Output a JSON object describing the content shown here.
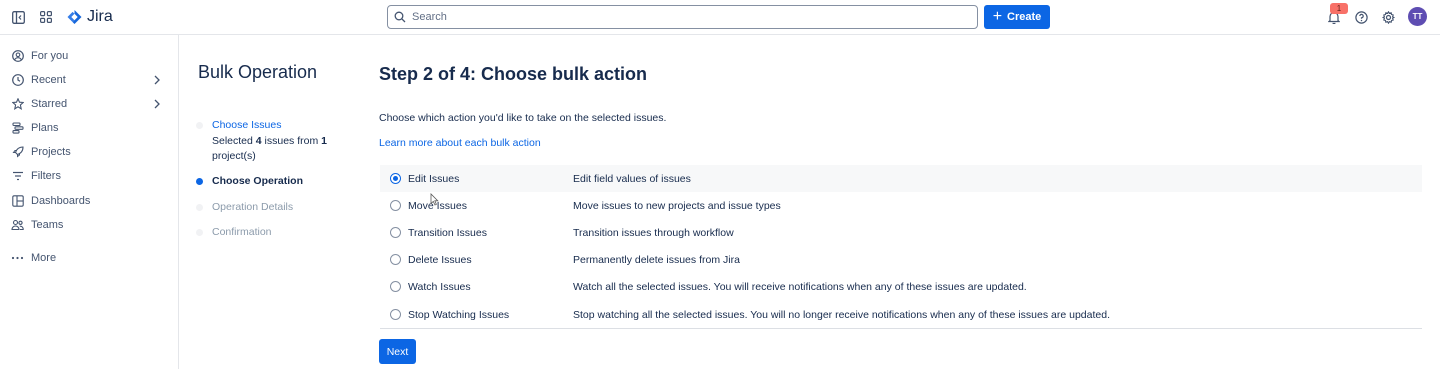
{
  "app": {
    "name": "Jira"
  },
  "topbar": {
    "search_placeholder": "Search",
    "create_label": "Create",
    "notification_count": "1",
    "avatar_initials": "TT"
  },
  "sidebar": {
    "items": [
      {
        "label": "For you",
        "icon": "person-circle-icon"
      },
      {
        "label": "Recent",
        "icon": "clock-icon"
      },
      {
        "label": "Starred",
        "icon": "star-icon"
      },
      {
        "label": "Plans",
        "icon": "plans-icon"
      },
      {
        "label": "Projects",
        "icon": "rocket-icon"
      },
      {
        "label": "Filters",
        "icon": "filter-icon"
      },
      {
        "label": "Dashboards",
        "icon": "dashboard-icon"
      },
      {
        "label": "Teams",
        "icon": "people-icon"
      },
      {
        "label": "More",
        "icon": "more-dots-icon"
      }
    ]
  },
  "wizard": {
    "title": "Bulk Operation",
    "steps": [
      {
        "label": "Choose Issues",
        "state": "done"
      },
      {
        "label": "Choose Operation",
        "state": "current"
      },
      {
        "label": "Operation Details",
        "state": "todo"
      },
      {
        "label": "Confirmation",
        "state": "todo"
      }
    ],
    "selection_summary": {
      "prefix": "Selected ",
      "issue_count": "4",
      "middle": " issues from ",
      "project_count": "1",
      "suffix": " project(s)"
    }
  },
  "main": {
    "title": "Step 2 of 4: Choose bulk action",
    "intro": "Choose which action you'd like to take on the selected issues.",
    "learn_more": "Learn more about each bulk action",
    "options": [
      {
        "label": "Edit Issues",
        "description": "Edit field values of issues",
        "selected": true
      },
      {
        "label": "Move Issues",
        "description": "Move issues to new projects and issue types",
        "selected": false
      },
      {
        "label": "Transition Issues",
        "description": "Transition issues through workflow",
        "selected": false
      },
      {
        "label": "Delete Issues",
        "description": "Permanently delete issues from Jira",
        "selected": false
      },
      {
        "label": "Watch Issues",
        "description": "Watch all the selected issues. You will receive notifications when any of these issues are updated.",
        "selected": false
      },
      {
        "label": "Stop Watching Issues",
        "description": "Stop watching all the selected issues. You will no longer receive notifications when any of these issues are updated.",
        "selected": false
      }
    ],
    "next_label": "Next"
  },
  "colors": {
    "primary": "#0c66e4",
    "text": "#172b4d",
    "subtle_text": "#44546f",
    "muted_step": "#8c9bab",
    "notification_badge": "#f87168",
    "avatar": "#5e4db2"
  }
}
